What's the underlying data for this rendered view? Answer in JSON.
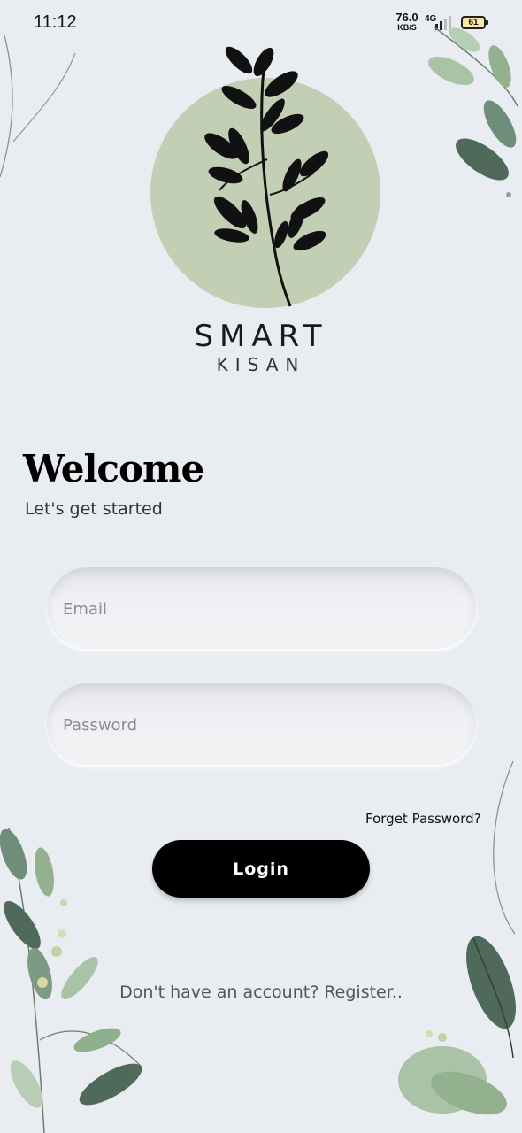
{
  "status_bar": {
    "time": "11:12",
    "net_speed_value": "76.0",
    "net_speed_unit": "KB/S",
    "network_type": "4G",
    "battery_level": "61"
  },
  "brand": {
    "name": "SMART",
    "subtitle": "KISAN",
    "logo_icon": "plant-logo-icon",
    "logo_circle_color": "#c3cfb4"
  },
  "welcome": {
    "title": "Welcome",
    "subtitle": "Let's get started"
  },
  "form": {
    "email_placeholder": "Email",
    "password_placeholder": "Password",
    "forgot_label": "Forget Password?",
    "login_label": "Login"
  },
  "footer": {
    "register_text": "Don't have an account? Register.."
  },
  "colors": {
    "background": "#e9edf1",
    "button": "#000000",
    "leaf_dark": "#4f6a5a",
    "leaf_light": "#a9c3a7"
  }
}
